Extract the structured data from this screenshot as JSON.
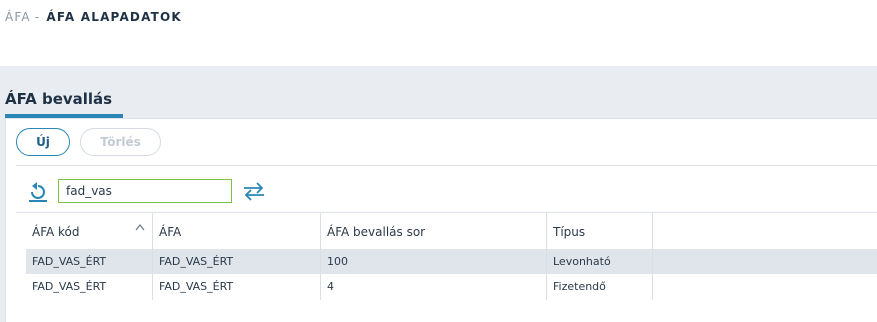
{
  "breadcrumb": {
    "parent": "ÁFA",
    "separator": "-",
    "current": "ÁFA ALAPADATOK"
  },
  "tab": {
    "label": "ÁFA bevallás"
  },
  "toolbar": {
    "new_label": "Új",
    "delete_label": "Törlés"
  },
  "filter": {
    "value": "fad_vas",
    "reset_icon": "refresh-icon",
    "swap_icon": "swap-arrows-icon"
  },
  "grid": {
    "columns": [
      "ÁFA kód",
      "ÁFA",
      "ÁFA bevallás sor",
      "Típus"
    ],
    "sort": "ascending",
    "rows": [
      {
        "code": "FAD_VAS_ÉRT",
        "afa": "FAD_VAS_ÉRT",
        "sor": "100",
        "tipus": "Levonható",
        "selected": true
      },
      {
        "code": "FAD_VAS_ÉRT",
        "afa": "FAD_VAS_ÉRT",
        "sor": "4",
        "tipus": "Fizetendő",
        "selected": false
      }
    ]
  },
  "colors": {
    "accent": "#2a86b5",
    "input_border": "#7cc142",
    "selected_row": "#dfe5ea",
    "band": "#e9edf1"
  }
}
